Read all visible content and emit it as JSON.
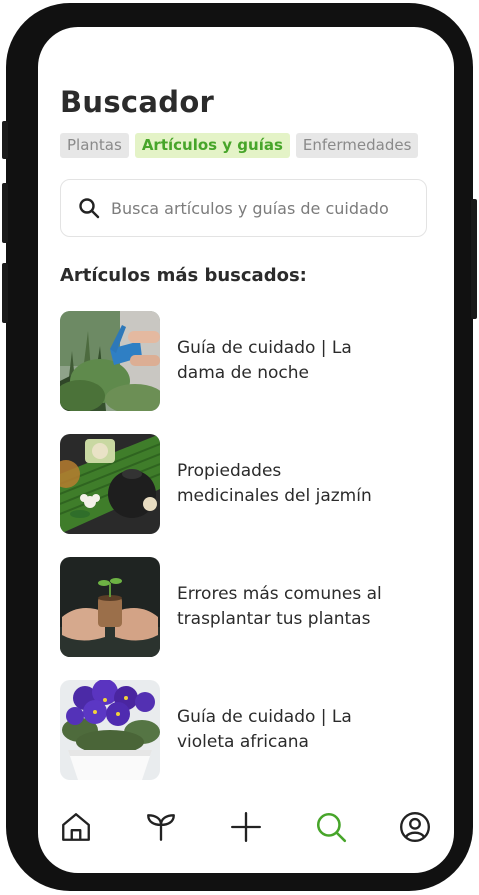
{
  "page": {
    "title": "Buscador"
  },
  "tabs": [
    {
      "label": "Plantas",
      "active": false
    },
    {
      "label": "Artículos y guías",
      "active": true
    },
    {
      "label": "Enfermedades",
      "active": false
    }
  ],
  "search": {
    "placeholder": "Busca artículos y guías de cuidado",
    "icon": "search-icon"
  },
  "section": {
    "title": "Artículos más buscados:"
  },
  "articles": [
    {
      "title": "Guía de cuidado | La\ndama de noche",
      "thumbnail": "watering-plants-photo"
    },
    {
      "title": "Propiedades\nmedicinales del jazmín",
      "thumbnail": "jasmine-tea-photo"
    },
    {
      "title": "Errores más comunes al\ntrasplantar tus plantas",
      "thumbnail": "seedling-hands-photo"
    },
    {
      "title": "Guía de cuidado | La\nvioleta africana",
      "thumbnail": "african-violet-photo"
    }
  ],
  "nav": {
    "items": [
      "home-icon",
      "sprout-icon",
      "plus-icon",
      "search-icon",
      "profile-icon"
    ],
    "active": "search-icon"
  },
  "colors": {
    "accent": "#47a52a",
    "accent_bg": "#e4f3c7",
    "text": "#2b2b2b",
    "tab_bg": "#e7e7e7",
    "tab_text": "#8a8a8a",
    "frame": "#111111"
  }
}
